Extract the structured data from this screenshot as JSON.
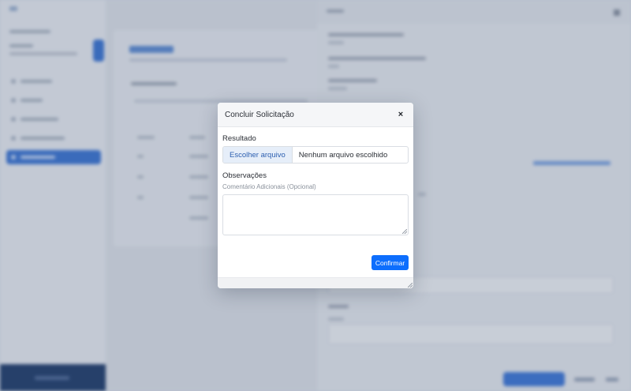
{
  "modal": {
    "title": "Concluir Solicitação",
    "close_icon": "×",
    "result_label": "Resultado",
    "file_button_label": "Escolher arquivo",
    "file_name": "Nenhum arquivo escolhido",
    "observations_label": "Observações",
    "observations_hint": "Comentário Adicionais (Opcional)",
    "confirm_label": "Confirmar"
  },
  "colors": {
    "primary": "#0d6efd",
    "file_button_bg": "#e6eef9",
    "overlay": "#c9d1dd"
  },
  "icons": {
    "close": "close-icon",
    "resize": "resize-grip-icon"
  }
}
